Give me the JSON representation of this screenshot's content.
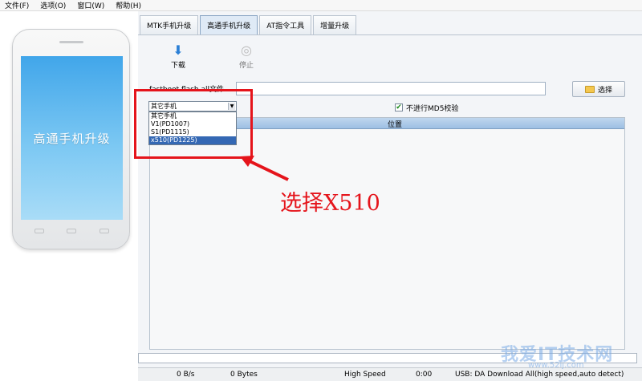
{
  "menu": [
    "文件(F)",
    "选项(O)",
    "窗口(W)",
    "帮助(H)"
  ],
  "phone": {
    "screen_text": "高通手机升级"
  },
  "tabs": [
    "MTK手机升级",
    "高通手机升级",
    "AT指令工具",
    "增量升级"
  ],
  "active_tab": 1,
  "toolbar": {
    "download": "下载",
    "stop": "停止"
  },
  "fastboot": {
    "label": "fastboot flash all文件",
    "value": "",
    "select_button": "选择"
  },
  "checkbox": {
    "label": "不进行MD5校验",
    "checked": true
  },
  "dropdown": {
    "selected": "其它手机",
    "options": [
      "其它手机",
      "V1(PD1007)",
      "S1(PD1115)",
      "x510(PD1225)"
    ],
    "highlighted_index": 3
  },
  "table": {
    "column": "位置"
  },
  "annotation": "选择X510",
  "status": {
    "rate": "0 B/s",
    "bytes": "0 Bytes",
    "speed": "High Speed",
    "time": "0:00",
    "usb": "USB: DA Download All(high speed,auto detect)"
  },
  "watermark": {
    "text": "我爱IT技术网",
    "url": "www.52ij.com"
  },
  "colors": {
    "annotation": "#e5141b",
    "selected_option": "#3468b4",
    "header": "#9dbfe3"
  }
}
